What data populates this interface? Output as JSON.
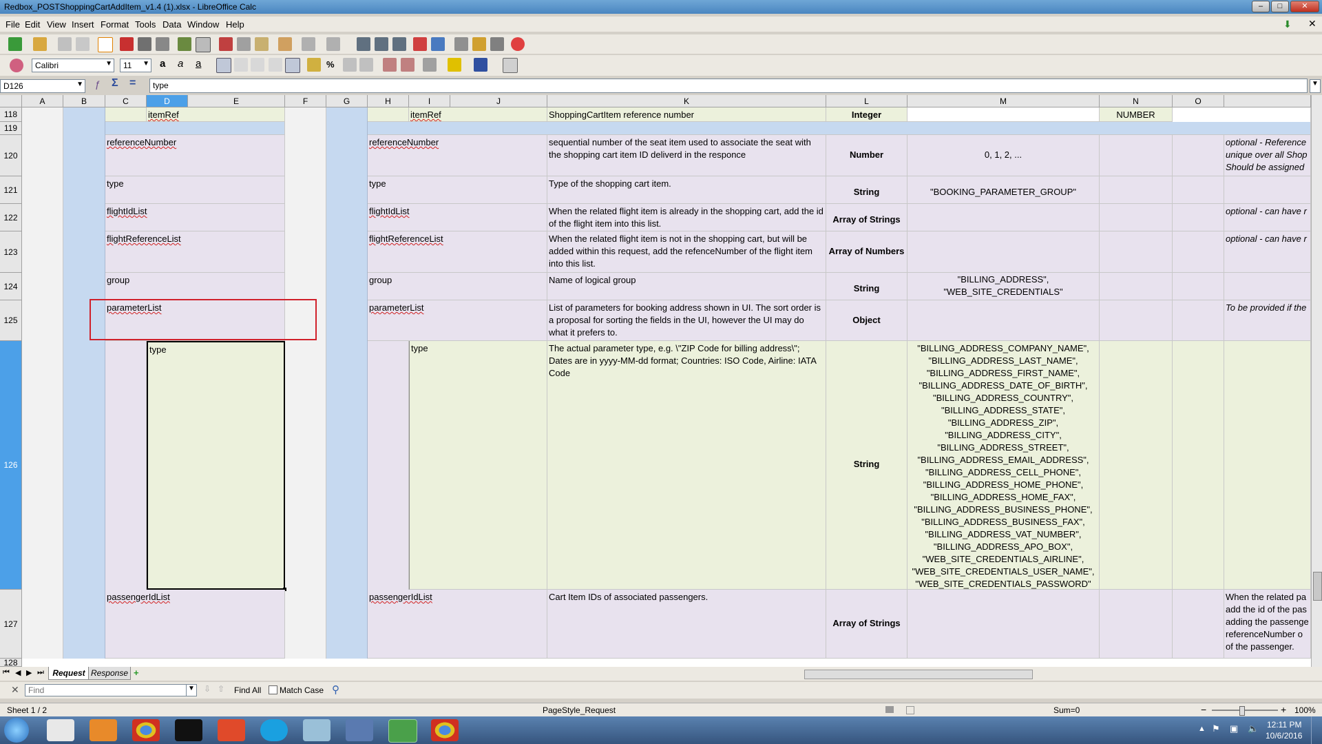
{
  "window": {
    "title": "Redbox_POSTShoppingCartAddItem_v1.4 (1).xlsx - LibreOffice Calc"
  },
  "menu": [
    "File",
    "Edit",
    "View",
    "Insert",
    "Format",
    "Tools",
    "Data",
    "Window",
    "Help"
  ],
  "format": {
    "font": "Calibri",
    "size": "11"
  },
  "formula": {
    "cell": "D126",
    "content": "type"
  },
  "columns": [
    "A",
    "B",
    "C",
    "D",
    "E",
    "F",
    "G",
    "H",
    "I",
    "J",
    "K",
    "L",
    "M",
    "N",
    "O"
  ],
  "rows": {
    "r118": {
      "num": "118",
      "d": "itemRef",
      "i": "itemRef",
      "k": "ShoppingCartItem reference number",
      "l": "Integer",
      "n": "NUMBER"
    },
    "r119": {
      "num": "119"
    },
    "r120": {
      "num": "120",
      "c": "referenceNumber",
      "h": "referenceNumber",
      "k": "sequential number of the seat item used to associate the seat with the shopping cart item ID deliverd in the responce",
      "l": "Number",
      "m": "0, 1, 2, ...",
      "p": "optional - Reference unique over all Shop Should be assigned v"
    },
    "r121": {
      "num": "121",
      "c": "type",
      "h": "type",
      "k": "Type of the shopping cart item.",
      "l": "String",
      "m": "\"BOOKING_PARAMETER_GROUP\""
    },
    "r122": {
      "num": "122",
      "c": "flightIdList",
      "h": "flightIdList",
      "k": "When the related flight item is already in the shopping cart, add the id of the flight item into this list.",
      "l": "Array of Strings",
      "p": "optional - can have r"
    },
    "r123": {
      "num": "123",
      "c": "flightReferenceList",
      "h": "flightReferenceList",
      "k": "When the related flight item is not in the shopping cart, but will be added within this request, add the refenceNumber of the flight item into this list.",
      "l": "Array of Numbers",
      "p": "optional - can have r"
    },
    "r124": {
      "num": "124",
      "c": "group",
      "h": "group",
      "k": "Name of logical group",
      "l": "String",
      "m": "\"BILLING_ADDRESS\", \"WEB_SITE_CREDENTIALS\""
    },
    "r125": {
      "num": "125",
      "c": "parameterList",
      "h": "parameterList",
      "k": "List of parameters for booking address shown in UI. The sort order is a proposal for sorting the fields in the UI, however the UI may do what it prefers to.",
      "l": "Object",
      "p": "To be provided if the"
    },
    "r126": {
      "num": "126",
      "d": "type",
      "i": "type",
      "k": "The actual parameter type, e.g. \\\"ZIP Code for billing address\\\"; Dates are in yyyy-MM-dd format; Countries: ISO Code, Airline: IATA Code",
      "l": "String",
      "m": "\"BILLING_ADDRESS_COMPANY_NAME\", \"BILLING_ADDRESS_LAST_NAME\", \"BILLING_ADDRESS_FIRST_NAME\", \"BILLING_ADDRESS_DATE_OF_BIRTH\", \"BILLING_ADDRESS_COUNTRY\", \"BILLING_ADDRESS_STATE\", \"BILLING_ADDRESS_ZIP\", \"BILLING_ADDRESS_CITY\", \"BILLING_ADDRESS_STREET\", \"BILLING_ADDRESS_EMAIL_ADDRESS\", \"BILLING_ADDRESS_CELL_PHONE\", \"BILLING_ADDRESS_HOME_PHONE\", \"BILLING_ADDRESS_HOME_FAX\", \"BILLING_ADDRESS_BUSINESS_PHONE\", \"BILLING_ADDRESS_BUSINESS_FAX\", \"BILLING_ADDRESS_VAT_NUMBER\", \"BILLING_ADDRESS_APO_BOX\", \"WEB_SITE_CREDENTIALS_AIRLINE\", \"WEB_SITE_CREDENTIALS_USER_NAME\", \"WEB_SITE_CREDENTIALS_PASSWORD\""
    },
    "r127": {
      "num": "127",
      "c": "passengerIdList",
      "h": "passengerIdList",
      "k": "Cart Item IDs of associated passengers.",
      "l": "Array of Strings",
      "p": "When the related pa add the id of the pas adding the passenge referenceNumber o of the passenger."
    },
    "r128": {
      "num": "128"
    }
  },
  "tabs": [
    "Request",
    "Response"
  ],
  "find": {
    "placeholder": "Find",
    "find_all": "Find All",
    "match_case": "Match Case"
  },
  "status": {
    "sheet": "Sheet 1 / 2",
    "pagestyle": "PageStyle_Request",
    "sum": "Sum=0",
    "zoom": "100%"
  },
  "clock": {
    "time": "12:11 PM",
    "date": "10/6/2016"
  },
  "colors": {
    "selection": "#4ca0e8",
    "lavender": "#e8e2ee",
    "green": "#ecf1dc",
    "blue": "#c6d9f0",
    "highlight_box": "#d0202a"
  }
}
